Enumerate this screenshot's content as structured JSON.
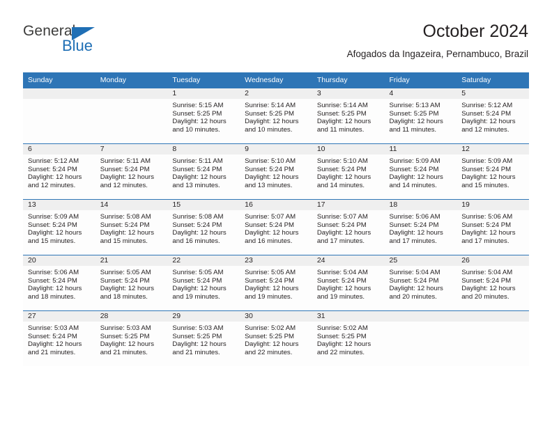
{
  "brand": {
    "name_part1": "General",
    "name_part2": "Blue",
    "triangle_icon": "triangle-icon",
    "accent_color": "#1f6fb5"
  },
  "header": {
    "title": "October 2024",
    "location": "Afogados da Ingazeira, Pernambuco, Brazil"
  },
  "colors": {
    "header_blue": "#2e75b6",
    "day_band_gray": "#efefef",
    "text": "#231f20"
  },
  "weekday_headers": [
    "Sunday",
    "Monday",
    "Tuesday",
    "Wednesday",
    "Thursday",
    "Friday",
    "Saturday"
  ],
  "weeks": [
    [
      {
        "day": "",
        "sunrise": "",
        "sunset": "",
        "daylight_line1": "",
        "daylight_line2": ""
      },
      {
        "day": "",
        "sunrise": "",
        "sunset": "",
        "daylight_line1": "",
        "daylight_line2": ""
      },
      {
        "day": "1",
        "sunrise": "Sunrise: 5:15 AM",
        "sunset": "Sunset: 5:25 PM",
        "daylight_line1": "Daylight: 12 hours",
        "daylight_line2": "and 10 minutes."
      },
      {
        "day": "2",
        "sunrise": "Sunrise: 5:14 AM",
        "sunset": "Sunset: 5:25 PM",
        "daylight_line1": "Daylight: 12 hours",
        "daylight_line2": "and 10 minutes."
      },
      {
        "day": "3",
        "sunrise": "Sunrise: 5:14 AM",
        "sunset": "Sunset: 5:25 PM",
        "daylight_line1": "Daylight: 12 hours",
        "daylight_line2": "and 11 minutes."
      },
      {
        "day": "4",
        "sunrise": "Sunrise: 5:13 AM",
        "sunset": "Sunset: 5:25 PM",
        "daylight_line1": "Daylight: 12 hours",
        "daylight_line2": "and 11 minutes."
      },
      {
        "day": "5",
        "sunrise": "Sunrise: 5:12 AM",
        "sunset": "Sunset: 5:24 PM",
        "daylight_line1": "Daylight: 12 hours",
        "daylight_line2": "and 12 minutes."
      }
    ],
    [
      {
        "day": "6",
        "sunrise": "Sunrise: 5:12 AM",
        "sunset": "Sunset: 5:24 PM",
        "daylight_line1": "Daylight: 12 hours",
        "daylight_line2": "and 12 minutes."
      },
      {
        "day": "7",
        "sunrise": "Sunrise: 5:11 AM",
        "sunset": "Sunset: 5:24 PM",
        "daylight_line1": "Daylight: 12 hours",
        "daylight_line2": "and 12 minutes."
      },
      {
        "day": "8",
        "sunrise": "Sunrise: 5:11 AM",
        "sunset": "Sunset: 5:24 PM",
        "daylight_line1": "Daylight: 12 hours",
        "daylight_line2": "and 13 minutes."
      },
      {
        "day": "9",
        "sunrise": "Sunrise: 5:10 AM",
        "sunset": "Sunset: 5:24 PM",
        "daylight_line1": "Daylight: 12 hours",
        "daylight_line2": "and 13 minutes."
      },
      {
        "day": "10",
        "sunrise": "Sunrise: 5:10 AM",
        "sunset": "Sunset: 5:24 PM",
        "daylight_line1": "Daylight: 12 hours",
        "daylight_line2": "and 14 minutes."
      },
      {
        "day": "11",
        "sunrise": "Sunrise: 5:09 AM",
        "sunset": "Sunset: 5:24 PM",
        "daylight_line1": "Daylight: 12 hours",
        "daylight_line2": "and 14 minutes."
      },
      {
        "day": "12",
        "sunrise": "Sunrise: 5:09 AM",
        "sunset": "Sunset: 5:24 PM",
        "daylight_line1": "Daylight: 12 hours",
        "daylight_line2": "and 15 minutes."
      }
    ],
    [
      {
        "day": "13",
        "sunrise": "Sunrise: 5:09 AM",
        "sunset": "Sunset: 5:24 PM",
        "daylight_line1": "Daylight: 12 hours",
        "daylight_line2": "and 15 minutes."
      },
      {
        "day": "14",
        "sunrise": "Sunrise: 5:08 AM",
        "sunset": "Sunset: 5:24 PM",
        "daylight_line1": "Daylight: 12 hours",
        "daylight_line2": "and 15 minutes."
      },
      {
        "day": "15",
        "sunrise": "Sunrise: 5:08 AM",
        "sunset": "Sunset: 5:24 PM",
        "daylight_line1": "Daylight: 12 hours",
        "daylight_line2": "and 16 minutes."
      },
      {
        "day": "16",
        "sunrise": "Sunrise: 5:07 AM",
        "sunset": "Sunset: 5:24 PM",
        "daylight_line1": "Daylight: 12 hours",
        "daylight_line2": "and 16 minutes."
      },
      {
        "day": "17",
        "sunrise": "Sunrise: 5:07 AM",
        "sunset": "Sunset: 5:24 PM",
        "daylight_line1": "Daylight: 12 hours",
        "daylight_line2": "and 17 minutes."
      },
      {
        "day": "18",
        "sunrise": "Sunrise: 5:06 AM",
        "sunset": "Sunset: 5:24 PM",
        "daylight_line1": "Daylight: 12 hours",
        "daylight_line2": "and 17 minutes."
      },
      {
        "day": "19",
        "sunrise": "Sunrise: 5:06 AM",
        "sunset": "Sunset: 5:24 PM",
        "daylight_line1": "Daylight: 12 hours",
        "daylight_line2": "and 17 minutes."
      }
    ],
    [
      {
        "day": "20",
        "sunrise": "Sunrise: 5:06 AM",
        "sunset": "Sunset: 5:24 PM",
        "daylight_line1": "Daylight: 12 hours",
        "daylight_line2": "and 18 minutes."
      },
      {
        "day": "21",
        "sunrise": "Sunrise: 5:05 AM",
        "sunset": "Sunset: 5:24 PM",
        "daylight_line1": "Daylight: 12 hours",
        "daylight_line2": "and 18 minutes."
      },
      {
        "day": "22",
        "sunrise": "Sunrise: 5:05 AM",
        "sunset": "Sunset: 5:24 PM",
        "daylight_line1": "Daylight: 12 hours",
        "daylight_line2": "and 19 minutes."
      },
      {
        "day": "23",
        "sunrise": "Sunrise: 5:05 AM",
        "sunset": "Sunset: 5:24 PM",
        "daylight_line1": "Daylight: 12 hours",
        "daylight_line2": "and 19 minutes."
      },
      {
        "day": "24",
        "sunrise": "Sunrise: 5:04 AM",
        "sunset": "Sunset: 5:24 PM",
        "daylight_line1": "Daylight: 12 hours",
        "daylight_line2": "and 19 minutes."
      },
      {
        "day": "25",
        "sunrise": "Sunrise: 5:04 AM",
        "sunset": "Sunset: 5:24 PM",
        "daylight_line1": "Daylight: 12 hours",
        "daylight_line2": "and 20 minutes."
      },
      {
        "day": "26",
        "sunrise": "Sunrise: 5:04 AM",
        "sunset": "Sunset: 5:24 PM",
        "daylight_line1": "Daylight: 12 hours",
        "daylight_line2": "and 20 minutes."
      }
    ],
    [
      {
        "day": "27",
        "sunrise": "Sunrise: 5:03 AM",
        "sunset": "Sunset: 5:24 PM",
        "daylight_line1": "Daylight: 12 hours",
        "daylight_line2": "and 21 minutes."
      },
      {
        "day": "28",
        "sunrise": "Sunrise: 5:03 AM",
        "sunset": "Sunset: 5:25 PM",
        "daylight_line1": "Daylight: 12 hours",
        "daylight_line2": "and 21 minutes."
      },
      {
        "day": "29",
        "sunrise": "Sunrise: 5:03 AM",
        "sunset": "Sunset: 5:25 PM",
        "daylight_line1": "Daylight: 12 hours",
        "daylight_line2": "and 21 minutes."
      },
      {
        "day": "30",
        "sunrise": "Sunrise: 5:02 AM",
        "sunset": "Sunset: 5:25 PM",
        "daylight_line1": "Daylight: 12 hours",
        "daylight_line2": "and 22 minutes."
      },
      {
        "day": "31",
        "sunrise": "Sunrise: 5:02 AM",
        "sunset": "Sunset: 5:25 PM",
        "daylight_line1": "Daylight: 12 hours",
        "daylight_line2": "and 22 minutes."
      },
      {
        "day": "",
        "sunrise": "",
        "sunset": "",
        "daylight_line1": "",
        "daylight_line2": ""
      },
      {
        "day": "",
        "sunrise": "",
        "sunset": "",
        "daylight_line1": "",
        "daylight_line2": ""
      }
    ]
  ]
}
